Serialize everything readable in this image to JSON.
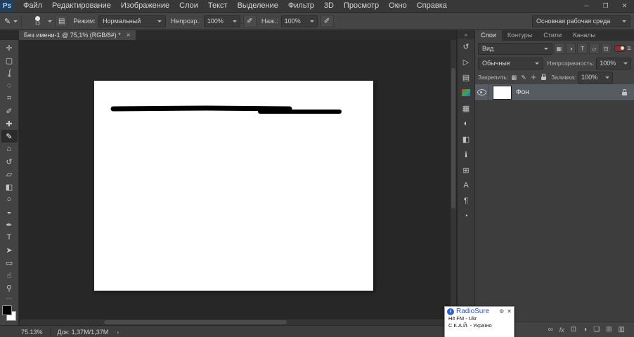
{
  "titlebar": {
    "logo": "Ps",
    "menus": [
      "Файл",
      "Редактирование",
      "Изображение",
      "Слои",
      "Текст",
      "Выделение",
      "Фильтр",
      "3D",
      "Просмотр",
      "Окно",
      "Справка"
    ],
    "minimize": "─",
    "maximize": "❐",
    "close": "✕"
  },
  "options_bar": {
    "tool_icon": "✎",
    "brush_size": "13",
    "panel_toggle_icon": "▤",
    "mode_label": "Режим:",
    "mode_value": "Нормальный",
    "opacity_label": "Непрозр.:",
    "opacity_value": "100%",
    "pressure_icon": "✐",
    "flow_label": "Наж.:",
    "flow_value": "100%",
    "airbrush_icon": "✐",
    "workspace_value": "Основная рабочая среда"
  },
  "tabbar": {
    "doc_title": "Без имени-1 @ 75,1% (RGB/8#) *",
    "close": "×"
  },
  "toolbar": {
    "tools": [
      {
        "id": "move",
        "glyph": "✛"
      },
      {
        "id": "rectangular-marquee",
        "glyph": "▢"
      },
      {
        "id": "lasso",
        "glyph": "ʆ"
      },
      {
        "id": "quick-selection",
        "glyph": "◌"
      },
      {
        "id": "crop",
        "glyph": "⌗"
      },
      {
        "id": "eyedropper",
        "glyph": "✐"
      },
      {
        "id": "spot-healing-brush",
        "glyph": "✚"
      },
      {
        "id": "brush",
        "glyph": "✎"
      },
      {
        "id": "clone-stamp",
        "glyph": "⌂"
      },
      {
        "id": "history-brush",
        "glyph": "↺"
      },
      {
        "id": "eraser",
        "glyph": "▱"
      },
      {
        "id": "gradient",
        "glyph": "◧"
      },
      {
        "id": "blur",
        "glyph": "○"
      },
      {
        "id": "dodge",
        "glyph": "◒"
      },
      {
        "id": "pen",
        "glyph": "✒"
      },
      {
        "id": "type",
        "glyph": "T"
      },
      {
        "id": "path-selection",
        "glyph": "➤"
      },
      {
        "id": "rectangle",
        "glyph": "▭"
      },
      {
        "id": "hand",
        "glyph": "☝"
      },
      {
        "id": "zoom",
        "glyph": "⚲"
      }
    ],
    "more": "⋯"
  },
  "dock": {
    "collapse": "«",
    "icons": [
      {
        "id": "history",
        "glyph": "↺"
      },
      {
        "id": "device-preview",
        "glyph": "▷"
      },
      {
        "id": "libraries",
        "glyph": "▤"
      },
      {
        "id": "color",
        "glyph": ""
      },
      {
        "id": "swatches",
        "glyph": "▦"
      },
      {
        "id": "adjustments",
        "glyph": "◐"
      },
      {
        "id": "styles",
        "glyph": "◧"
      },
      {
        "id": "info",
        "glyph": "ℹ"
      },
      {
        "id": "glyphs",
        "glyph": "⊞"
      },
      {
        "id": "character",
        "glyph": "А"
      },
      {
        "id": "paragraph",
        "glyph": "¶"
      },
      {
        "id": "histogram",
        "glyph": "◔"
      }
    ]
  },
  "panels": {
    "tabs": [
      "Слои",
      "Контуры",
      "Стили",
      "Каналы"
    ],
    "panel_menu_icon": "≡",
    "filter": {
      "kind_value": "Вид",
      "icons": [
        {
          "id": "filter-pixel-layers",
          "glyph": "▦"
        },
        {
          "id": "filter-adjustment-layers",
          "glyph": "◑"
        },
        {
          "id": "filter-type-layers",
          "glyph": "T"
        },
        {
          "id": "filter-shape-layers",
          "glyph": "▱"
        },
        {
          "id": "filter-smart-objects",
          "glyph": "⊡"
        }
      ]
    },
    "blend_value": "Обычные",
    "opacity_label": "Непрозрачность:",
    "opacity_value": "100%",
    "lock_label": "Закрепить:",
    "lock_icons": [
      {
        "id": "lock-transparency",
        "glyph": "▦"
      },
      {
        "id": "lock-pixels",
        "glyph": "✎"
      },
      {
        "id": "lock-position",
        "glyph": "✛"
      },
      {
        "id": "lock-all",
        "glyph": ""
      }
    ],
    "fill_label": "Заливка:",
    "fill_value": "100%",
    "layers": [
      {
        "name": "Фон",
        "locked": true
      }
    ],
    "bottom": [
      {
        "id": "link-layers",
        "glyph": "∞"
      },
      {
        "id": "layer-effects",
        "glyph": "fx"
      },
      {
        "id": "add-layer-mask",
        "glyph": "⊡"
      },
      {
        "id": "new-adjustment-layer",
        "glyph": "◑"
      },
      {
        "id": "new-group",
        "glyph": "❏"
      },
      {
        "id": "new-layer",
        "glyph": "⊞"
      },
      {
        "id": "delete-layer",
        "glyph": "▥"
      }
    ]
  },
  "status_bar": {
    "zoom": "75.13%",
    "doc_info": "Док: 1,37M/1,37M",
    "arrow": "›"
  },
  "radiosure": {
    "info_icon": "i",
    "title": "RadioSure",
    "wrench_icon": "⚙",
    "close_icon": "✕",
    "line1": "Hit FM - Ukr",
    "line2": "С.К.А.Й. - Україно"
  },
  "colors": {
    "radiosure_blue": "#2b55c8",
    "brush_stroke": "#000000",
    "canvas_white": "#ffffff"
  }
}
